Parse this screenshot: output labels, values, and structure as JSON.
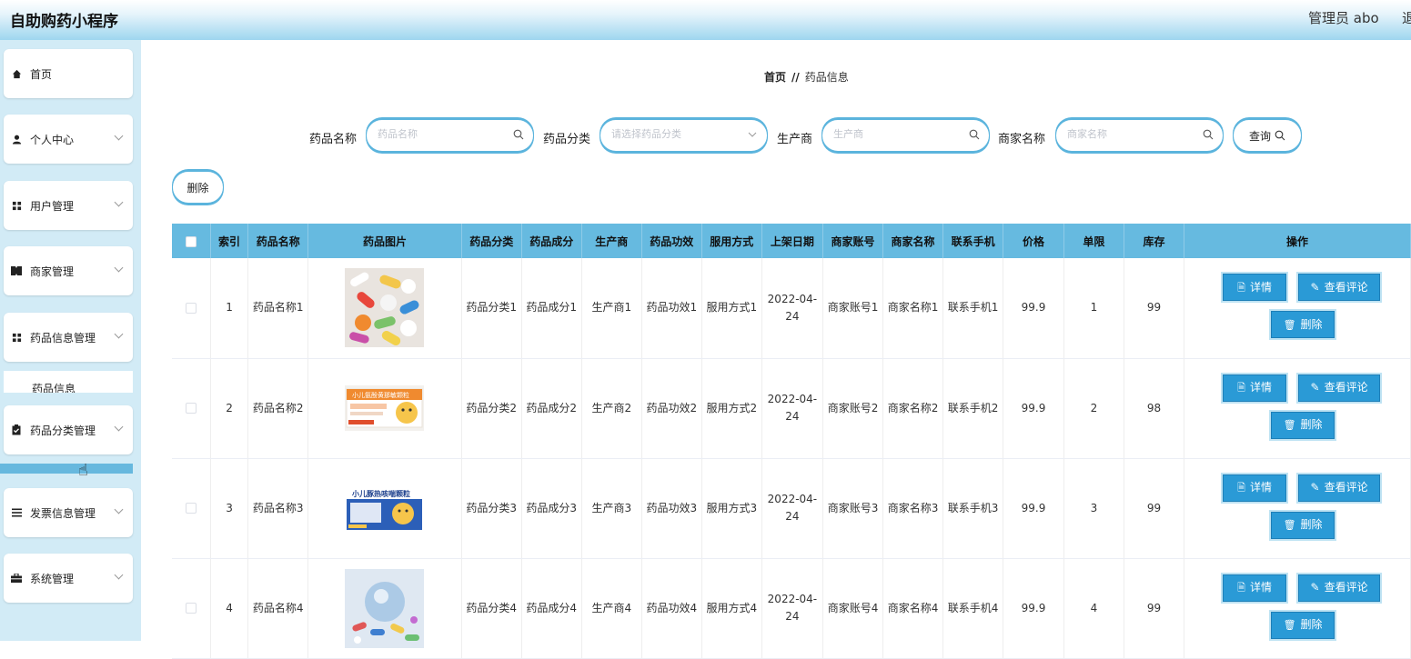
{
  "header": {
    "title": "自助购药小程序",
    "admin": "管理员 abo",
    "logout": "退出"
  },
  "sidebar": {
    "items": [
      {
        "label": "首页",
        "icon": "home-icon"
      },
      {
        "label": "个人中心",
        "icon": "user-icon"
      },
      {
        "label": "用户管理",
        "icon": "grid-icon"
      },
      {
        "label": "商家管理",
        "icon": "ticket-icon"
      },
      {
        "label": "药品信息管理",
        "icon": "grid-icon"
      },
      {
        "label": "药品分类管理",
        "icon": "clipboard-icon"
      },
      {
        "label": "发票信息管理",
        "icon": "list-icon"
      },
      {
        "label": "系统管理",
        "icon": "briefcase-icon"
      }
    ],
    "sub_item": "药品信息"
  },
  "breadcrumb": {
    "home": "首页",
    "sep": "//",
    "current": "药品信息"
  },
  "search": {
    "name_label": "药品名称",
    "name_placeholder": "药品名称",
    "category_label": "药品分类",
    "category_placeholder": "请选择药品分类",
    "maker_label": "生产商",
    "maker_placeholder": "生产商",
    "merchant_label": "商家名称",
    "merchant_placeholder": "商家名称",
    "query_button": "查询"
  },
  "toolbar": {
    "delete_button": "删除"
  },
  "table": {
    "headers": [
      "",
      "索引",
      "药品名称",
      "药品图片",
      "药品分类",
      "药品成分",
      "生产商",
      "药品功效",
      "服用方式",
      "上架日期",
      "商家账号",
      "商家名称",
      "联系手机",
      "价格",
      "单限",
      "库存",
      "操作"
    ],
    "rows": [
      {
        "index": "1",
        "name": "药品名称1",
        "category": "药品分类1",
        "ingredient": "药品成分1",
        "maker": "生产商1",
        "effect": "药品功效1",
        "usage": "服用方式1",
        "date": "2022-04-24",
        "account": "商家账号1",
        "merchant": "商家名称1",
        "phone": "联系手机1",
        "price": "99.9",
        "limit": "1",
        "stock": "99"
      },
      {
        "index": "2",
        "name": "药品名称2",
        "category": "药品分类2",
        "ingredient": "药品成分2",
        "maker": "生产商2",
        "effect": "药品功效2",
        "usage": "服用方式2",
        "date": "2022-04-24",
        "account": "商家账号2",
        "merchant": "商家名称2",
        "phone": "联系手机2",
        "price": "99.9",
        "limit": "2",
        "stock": "98"
      },
      {
        "index": "3",
        "name": "药品名称3",
        "category": "药品分类3",
        "ingredient": "药品成分3",
        "maker": "生产商3",
        "effect": "药品功效3",
        "usage": "服用方式3",
        "date": "2022-04-24",
        "account": "商家账号3",
        "merchant": "商家名称3",
        "phone": "联系手机3",
        "price": "99.9",
        "limit": "3",
        "stock": "99"
      },
      {
        "index": "4",
        "name": "药品名称4",
        "category": "药品分类4",
        "ingredient": "药品成分4",
        "maker": "生产商4",
        "effect": "药品功效4",
        "usage": "服用方式4",
        "date": "2022-04-24",
        "account": "商家账号4",
        "merchant": "商家名称4",
        "phone": "联系手机4",
        "price": "99.9",
        "limit": "4",
        "stock": "99"
      }
    ],
    "row_buttons": {
      "detail": "详情",
      "reviews": "查看评论",
      "delete": "删除"
    },
    "box_text": {
      "row2": "小儿氨酚黄那敏颗粒",
      "row3": "小儿豚热咳喘颗粒"
    }
  },
  "colors": {
    "accent": "#66bae0",
    "button": "#2a9ad6",
    "sidebar_bg": "#d2ebf6"
  }
}
